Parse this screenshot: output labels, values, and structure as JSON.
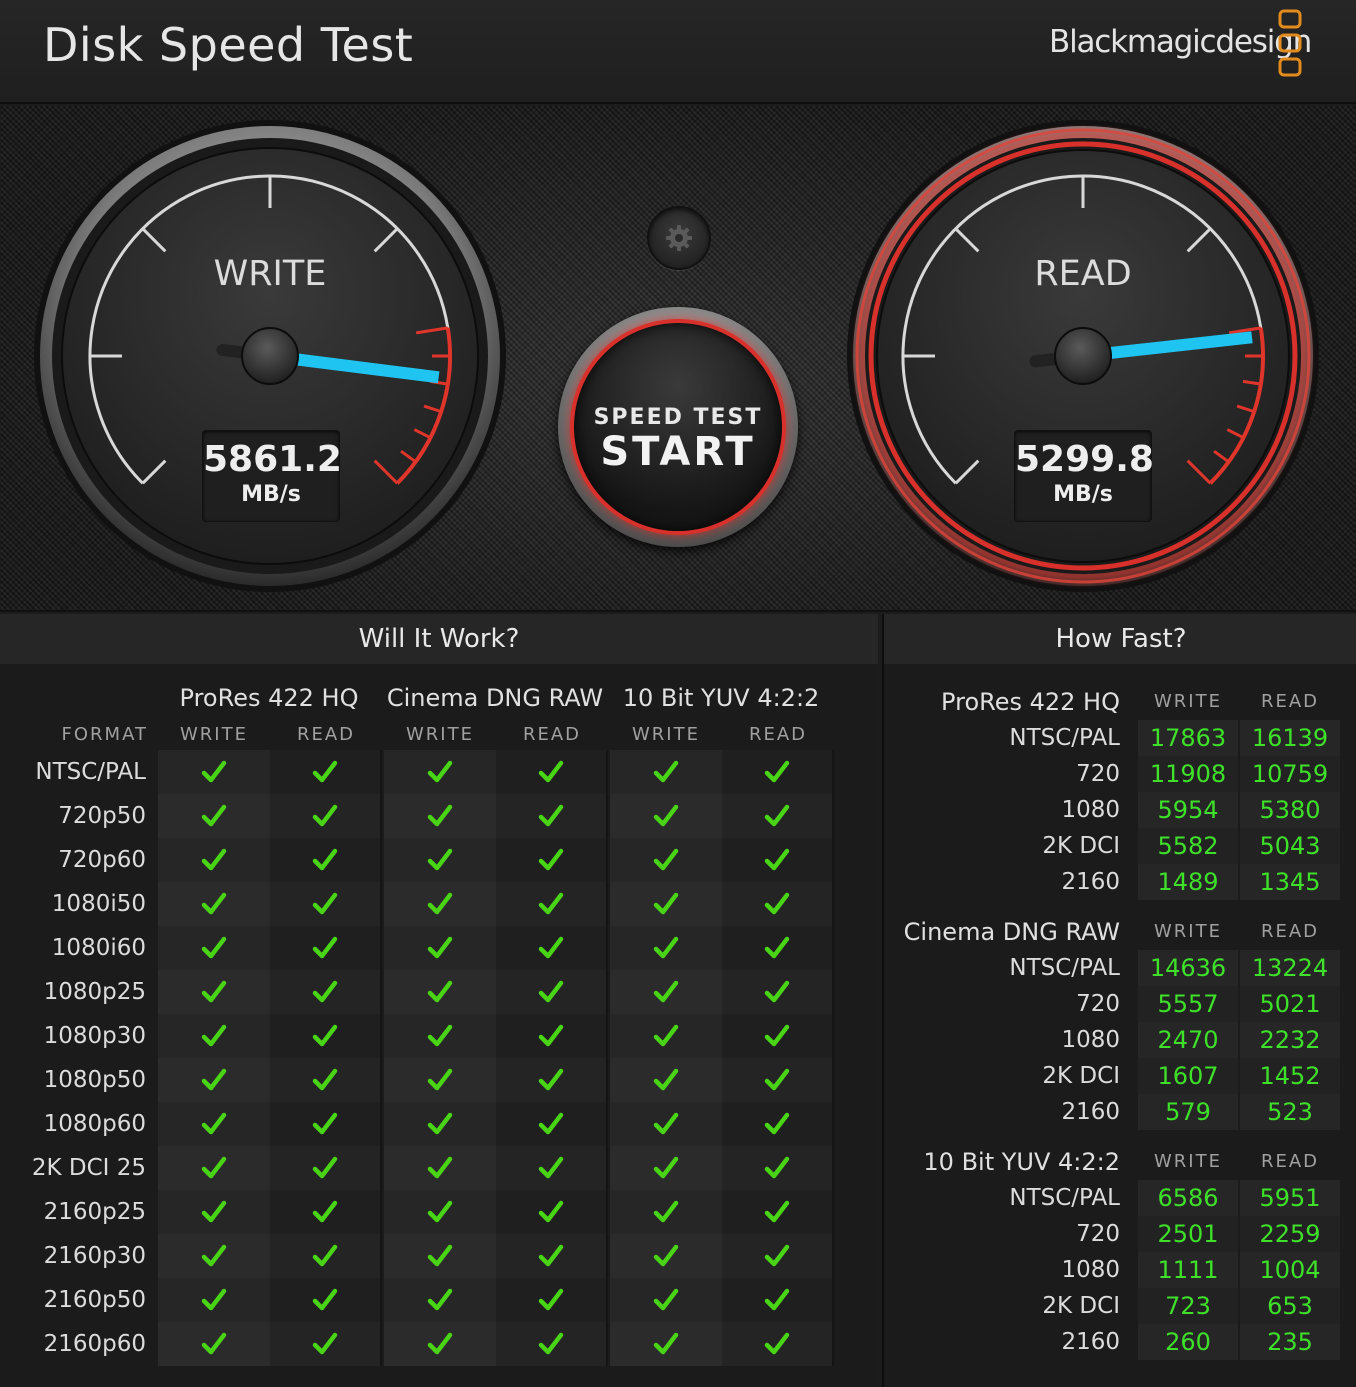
{
  "header": {
    "title": "Disk Speed Test",
    "brand": "Blackmagicdesign"
  },
  "colors": {
    "accent_red": "#d8302a",
    "needle_blue": "#1fc4f0",
    "check_green": "#49d416",
    "number_green": "#3ee02a"
  },
  "gauges": {
    "write": {
      "label": "WRITE",
      "value": "5861.2",
      "unit": "MB/s",
      "needle_level": 0.86
    },
    "read": {
      "label": "READ",
      "value": "5299.8",
      "unit": "MB/s",
      "needle_level": 0.81
    }
  },
  "controls": {
    "settings_icon": "gear-icon",
    "start_top": "SPEED TEST",
    "start_main": "START"
  },
  "will_it_work": {
    "title": "Will It Work?",
    "format_header": "FORMAT",
    "groups": [
      "ProRes 422 HQ",
      "Cinema DNG RAW",
      "10 Bit YUV 4:2:2"
    ],
    "columns": [
      "WRITE",
      "READ",
      "WRITE",
      "READ",
      "WRITE",
      "READ"
    ],
    "rows": [
      {
        "format": "NTSC/PAL",
        "checks": [
          true,
          true,
          true,
          true,
          true,
          true
        ]
      },
      {
        "format": "720p50",
        "checks": [
          true,
          true,
          true,
          true,
          true,
          true
        ]
      },
      {
        "format": "720p60",
        "checks": [
          true,
          true,
          true,
          true,
          true,
          true
        ]
      },
      {
        "format": "1080i50",
        "checks": [
          true,
          true,
          true,
          true,
          true,
          true
        ]
      },
      {
        "format": "1080i60",
        "checks": [
          true,
          true,
          true,
          true,
          true,
          true
        ]
      },
      {
        "format": "1080p25",
        "checks": [
          true,
          true,
          true,
          true,
          true,
          true
        ]
      },
      {
        "format": "1080p30",
        "checks": [
          true,
          true,
          true,
          true,
          true,
          true
        ]
      },
      {
        "format": "1080p50",
        "checks": [
          true,
          true,
          true,
          true,
          true,
          true
        ]
      },
      {
        "format": "1080p60",
        "checks": [
          true,
          true,
          true,
          true,
          true,
          true
        ]
      },
      {
        "format": "2K DCI 25",
        "checks": [
          true,
          true,
          true,
          true,
          true,
          true
        ]
      },
      {
        "format": "2160p25",
        "checks": [
          true,
          true,
          true,
          true,
          true,
          true
        ]
      },
      {
        "format": "2160p30",
        "checks": [
          true,
          true,
          true,
          true,
          true,
          true
        ]
      },
      {
        "format": "2160p50",
        "checks": [
          true,
          true,
          true,
          true,
          true,
          true
        ]
      },
      {
        "format": "2160p60",
        "checks": [
          true,
          true,
          true,
          true,
          true,
          true
        ]
      }
    ]
  },
  "how_fast": {
    "title": "How Fast?",
    "groups": [
      {
        "name": "ProRes 422 HQ",
        "write_label": "WRITE",
        "read_label": "READ",
        "rows": [
          {
            "res": "NTSC/PAL",
            "write": "17863",
            "read": "16139"
          },
          {
            "res": "720",
            "write": "11908",
            "read": "10759"
          },
          {
            "res": "1080",
            "write": "5954",
            "read": "5380"
          },
          {
            "res": "2K DCI",
            "write": "5582",
            "read": "5043"
          },
          {
            "res": "2160",
            "write": "1489",
            "read": "1345"
          }
        ]
      },
      {
        "name": "Cinema DNG RAW",
        "write_label": "WRITE",
        "read_label": "READ",
        "rows": [
          {
            "res": "NTSC/PAL",
            "write": "14636",
            "read": "13224"
          },
          {
            "res": "720",
            "write": "5557",
            "read": "5021"
          },
          {
            "res": "1080",
            "write": "2470",
            "read": "2232"
          },
          {
            "res": "2K DCI",
            "write": "1607",
            "read": "1452"
          },
          {
            "res": "2160",
            "write": "579",
            "read": "523"
          }
        ]
      },
      {
        "name": "10 Bit YUV 4:2:2",
        "write_label": "WRITE",
        "read_label": "READ",
        "rows": [
          {
            "res": "NTSC/PAL",
            "write": "6586",
            "read": "5951"
          },
          {
            "res": "720",
            "write": "2501",
            "read": "2259"
          },
          {
            "res": "1080",
            "write": "1111",
            "read": "1004"
          },
          {
            "res": "2K DCI",
            "write": "723",
            "read": "653"
          },
          {
            "res": "2160",
            "write": "260",
            "read": "235"
          }
        ]
      }
    ]
  }
}
